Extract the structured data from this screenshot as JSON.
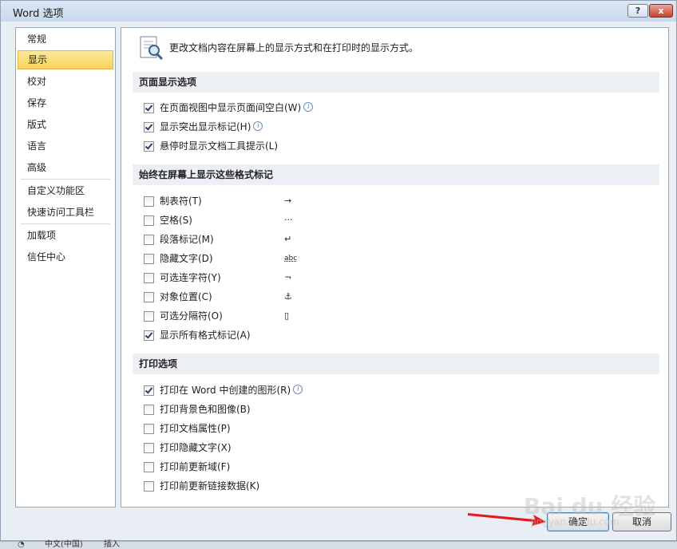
{
  "window": {
    "title": "Word 选项",
    "help_label": "?",
    "close_label": "x"
  },
  "nav": {
    "items": [
      {
        "label": "常规"
      },
      {
        "label": "显示"
      },
      {
        "label": "校对"
      },
      {
        "label": "保存"
      },
      {
        "label": "版式"
      },
      {
        "label": "语言"
      },
      {
        "label": "高级"
      },
      {
        "label": "自定义功能区"
      },
      {
        "label": "快速访问工具栏"
      },
      {
        "label": "加载项"
      },
      {
        "label": "信任中心"
      }
    ],
    "selected": "显示"
  },
  "main": {
    "header_text": "更改文档内容在屏幕上的显示方式和在打印时的显示方式。",
    "sections": [
      {
        "title": "页面显示选项",
        "options": [
          {
            "label": "在页面视图中显示页面间空白(W)",
            "checked": true,
            "info": true
          },
          {
            "label": "显示突出显示标记(H)",
            "checked": true,
            "info": true
          },
          {
            "label": "悬停时显示文档工具提示(L)",
            "checked": true,
            "info": false
          }
        ]
      },
      {
        "title": "始终在屏幕上显示这些格式标记",
        "options": [
          {
            "label": "制表符(T)",
            "checked": false,
            "symbol": "→"
          },
          {
            "label": "空格(S)",
            "checked": false,
            "symbol": "···"
          },
          {
            "label": "段落标记(M)",
            "checked": false,
            "symbol": "↵"
          },
          {
            "label": "隐藏文字(D)",
            "checked": false,
            "symbol": "abc"
          },
          {
            "label": "可选连字符(Y)",
            "checked": false,
            "symbol": "¬"
          },
          {
            "label": "对象位置(C)",
            "checked": false,
            "symbol": "⚓"
          },
          {
            "label": "可选分隔符(O)",
            "checked": false,
            "symbol": "▯"
          },
          {
            "label": "显示所有格式标记(A)",
            "checked": true,
            "symbol": ""
          }
        ]
      },
      {
        "title": "打印选项",
        "options": [
          {
            "label": "打印在 Word 中创建的图形(R)",
            "checked": true,
            "info": true
          },
          {
            "label": "打印背景色和图像(B)",
            "checked": false,
            "info": false
          },
          {
            "label": "打印文档属性(P)",
            "checked": false,
            "info": false
          },
          {
            "label": "打印隐藏文字(X)",
            "checked": false,
            "info": false
          },
          {
            "label": "打印前更新域(F)",
            "checked": false,
            "info": false
          },
          {
            "label": "打印前更新链接数据(K)",
            "checked": false,
            "info": false
          }
        ]
      }
    ]
  },
  "buttons": {
    "ok_label": "确定",
    "cancel_label": "取消"
  },
  "taskbar": {
    "language_label": "中文(中国)",
    "insert_label": "插入"
  },
  "watermark": {
    "text": "Bai du 经验",
    "sub": "jingyan.baidu.com"
  },
  "colors": {
    "selected_bg": "#f9d35a",
    "section_bg": "#eceff3",
    "close_button": "#c3442e"
  }
}
